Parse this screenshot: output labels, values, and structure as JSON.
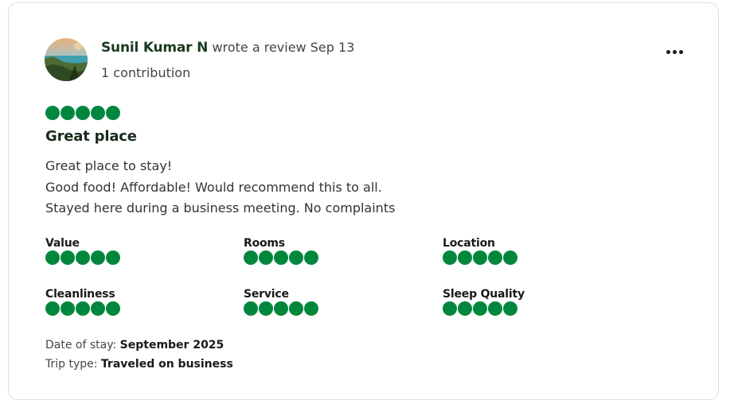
{
  "reviewer": {
    "name": "Sunil Kumar N",
    "action": "wrote a review Sep 13",
    "contributions": "1 contribution"
  },
  "review": {
    "rating": 5,
    "title": "Great place",
    "body": [
      "Great place to stay!",
      "Good food! Affordable! Would recommend this to all.",
      "Stayed here during a business meeting. No complaints"
    ]
  },
  "sub_ratings": [
    {
      "label": "Value",
      "rating": 5
    },
    {
      "label": "Rooms",
      "rating": 5
    },
    {
      "label": "Location",
      "rating": 5
    },
    {
      "label": "Cleanliness",
      "rating": 5
    },
    {
      "label": "Service",
      "rating": 5
    },
    {
      "label": "Sleep Quality",
      "rating": 5
    }
  ],
  "meta": {
    "date_label": "Date of stay:",
    "date_value": "September 2025",
    "trip_label": "Trip type:",
    "trip_value": "Traveled on business"
  },
  "colors": {
    "bubble": "#00873d"
  },
  "icons": {
    "more": "ellipsis-icon"
  }
}
